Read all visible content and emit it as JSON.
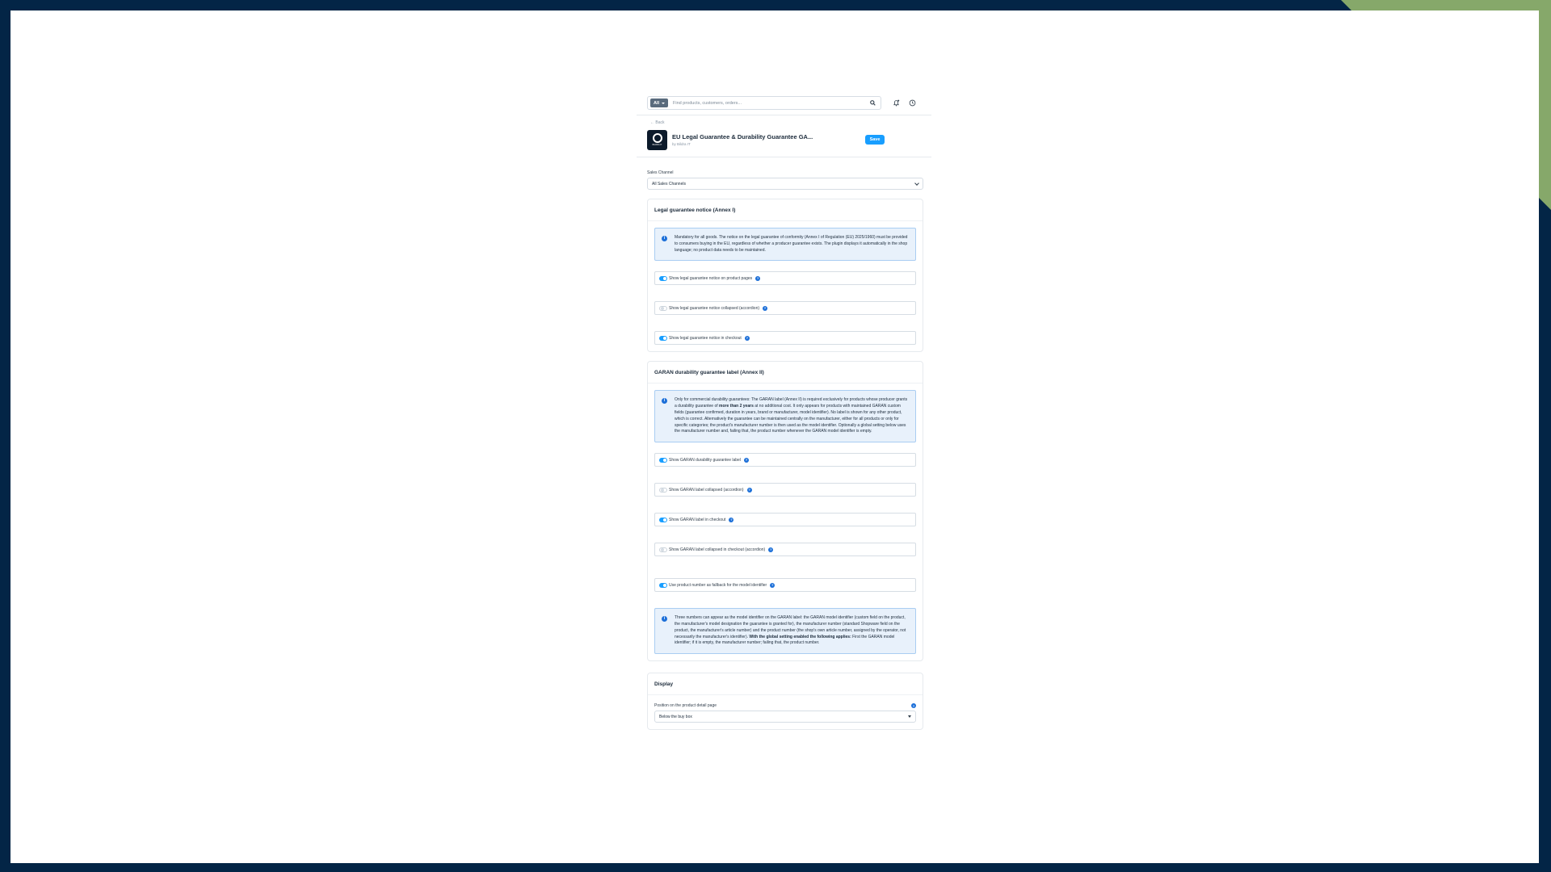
{
  "topbar": {
    "scope_label": "All",
    "search_placeholder": "Find products, customers, orders..."
  },
  "nav": {
    "back_label": "Back"
  },
  "plugin": {
    "title": "EU Legal Guarantee & Durability Guarantee GA...",
    "author": "by Bildra IT",
    "logo_text": "BILDRA IT",
    "save_label": "Save"
  },
  "sales_channel": {
    "label": "Sales Channel",
    "value": "All Sales Channels"
  },
  "legal_section": {
    "title": "Legal guarantee notice (Annex I)",
    "info": "Mandatory for all goods. The notice on the legal guarantee of conformity (Annex I of Regulation (EU) 2025/1960) must be provided to consumers buying in the EU, regardless of whether a producer guarantee exists. The plugin displays it automatically in the shop language; no product data needs to be maintained.",
    "toggles": [
      {
        "label": "Show legal guarantee notice on product pages",
        "on": true
      },
      {
        "label": "Show legal guarantee notice collapsed (accordion)",
        "on": false
      },
      {
        "label": "Show legal guarantee notice in checkout",
        "on": true
      }
    ]
  },
  "garan_section": {
    "title": "GARAN durability guarantee label (Annex II)",
    "info_pre": "Only for commercial durability guarantees: The GARAN label (Annex II) is required exclusively for products whose producer grants a durability guarantee of ",
    "info_bold": "more than 2 years",
    "info_post": " at no additional cost. It only appears for products with maintained GARAN custom fields (guarantee confirmed, duration in years, brand or manufacturer, model identifier). No label is shown for any other product, which is correct. Alternatively the guarantee can be maintained centrally on the manufacturer, either for all products or only for specific categories; the product's manufacturer number is then used as the model identifier. Optionally a global setting below uses the manufacturer number and, failing that, the product number whenever the GARAN model identifier is empty.",
    "toggles": [
      {
        "label": "Show GARAN durability guarantee label",
        "on": true
      },
      {
        "label": "Show GARAN label collapsed (accordion)",
        "on": false
      },
      {
        "label": "Show GARAN label in checkout",
        "on": true
      },
      {
        "label": "Show GARAN label collapsed in checkout (accordion)",
        "on": false
      }
    ],
    "fallback_toggle": {
      "label": "Use product number as fallback for the model identifier",
      "on": true
    },
    "info2_pre": "Three numbers can appear as the model identifier on the GARAN label: the GARAN model identifier (custom field on the product, the manufacturer's model designation the guarantee is granted for), the manufacturer number (standard Shopware field on the product, the manufacturer's article number) and the product number (the shop's own article number, assigned by the operator, not necessarily the manufacturer's identifier). ",
    "info2_bold": "With the global setting enabled the following applies:",
    "info2_post": " First the GARAN model identifier; if it is empty, the manufacturer number; failing that, the product number."
  },
  "display_section": {
    "title": "Display",
    "position_label": "Position on the product detail page",
    "position_value": "Below the buy box"
  },
  "colors": {
    "frame": "#032546",
    "accent_green": "#86a86a",
    "primary": "#189eff",
    "info_bg": "#e8f1fb"
  },
  "icons": [
    "search-icon",
    "bell-icon",
    "clock-icon",
    "chevron-down-icon",
    "info-icon",
    "help-icon"
  ]
}
